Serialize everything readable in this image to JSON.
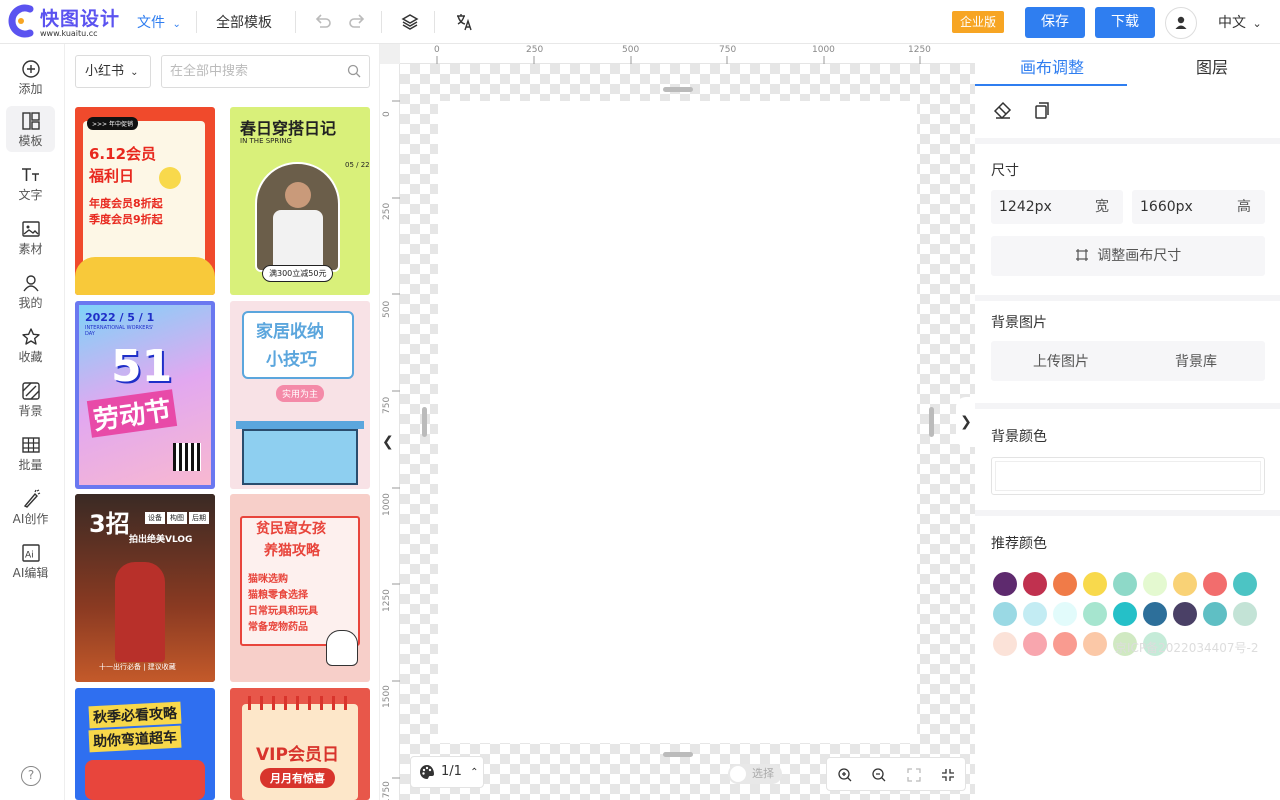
{
  "topbar": {
    "brand": "快图设计",
    "brand_url": "www.kuaitu.cc",
    "file_menu": "文件",
    "all_templates": "全部模板",
    "enterprise_badge": "企业版",
    "save_label": "保存",
    "download_label": "下载",
    "language": "中文"
  },
  "sidebar": {
    "items": [
      {
        "label": "添加",
        "icon": "plus-circle-icon"
      },
      {
        "label": "模板",
        "icon": "template-icon"
      },
      {
        "label": "文字",
        "icon": "text-icon"
      },
      {
        "label": "素材",
        "icon": "image-icon"
      },
      {
        "label": "我的",
        "icon": "user-icon"
      },
      {
        "label": "收藏",
        "icon": "star-icon"
      },
      {
        "label": "背景",
        "icon": "background-icon"
      },
      {
        "label": "批量",
        "icon": "grid-icon"
      },
      {
        "label": "AI创作",
        "icon": "ai-brush-icon"
      },
      {
        "label": "AI编辑",
        "icon": "ai-edit-icon"
      }
    ],
    "help": "?"
  },
  "templates": {
    "category": "小红书",
    "search_placeholder": "在全部中搜索",
    "cards": [
      {
        "title": "6.12会员福利日",
        "lines": [
          "年度会员8折起",
          "季度会员9折起"
        ],
        "tag": ">>> 年中促销",
        "bg": "#f04a2c",
        "inner": "#fdf7e6",
        "accent": "#e8281e"
      },
      {
        "title": "春日穿搭日记",
        "lines": [
          "IN THE SPRING",
          "满300立减50元"
        ],
        "date": "05 / 22",
        "bg": "#d9f07a",
        "inner": "#fbf9e8",
        "accent": "#222"
      },
      {
        "title": "51劳动节",
        "lines": [
          "2022 / 5 / 1",
          "INTERNATIONAL WORKERS' DAY"
        ],
        "big": "51",
        "sub": "劳动节",
        "bg": "#6a78f0",
        "inner": "#b8e0f8",
        "accent": "#1f2fc8"
      },
      {
        "title": "家居收纳小技巧",
        "lines": [
          "家居收纳",
          "小技巧"
        ],
        "tag": "实用为主",
        "bg": "#f8e2e6",
        "inner": "#fdf3f5",
        "accent": "#5ba6dd"
      },
      {
        "title": "3招拍出绝美VLOG",
        "lines": [
          "3招",
          "拍出绝美VLOG"
        ],
        "tags": [
          "设备",
          "构图",
          "后期"
        ],
        "footer": "十一出行必备 | 建议收藏",
        "bg": "#5a2a1c",
        "inner": "#7a3a22",
        "accent": "#fff"
      },
      {
        "title": "贫民窟女孩养猫攻略",
        "lines": [
          "贫民窟女孩",
          "养猫攻略"
        ],
        "list": [
          "猫咪选购",
          "猫粮零食选择",
          "日常玩具和玩具",
          "常备宠物药品"
        ],
        "bg": "#f7cfc9",
        "inner": "#fdf0ee",
        "accent": "#e8453c"
      },
      {
        "title": "秋季必看攻略 助你弯道超车",
        "lines": [
          "秋季必看攻略",
          "助你弯道超车"
        ],
        "bg": "#2f6ff0",
        "inner": "#f8d84a",
        "accent": "#222"
      },
      {
        "title": "VIP会员日",
        "lines": [
          "VIP会员日",
          "月月有惊喜"
        ],
        "bg": "#e8574a",
        "inner": "#fde7c9",
        "accent": "#d8342c"
      }
    ]
  },
  "canvas": {
    "ruler_top": [
      "0",
      "250",
      "500",
      "750",
      "1000",
      "1250"
    ],
    "ruler_left": [
      "0",
      "250",
      "500",
      "750",
      "1000",
      "1250",
      "1500",
      "1750"
    ],
    "page_indicator": "1/1",
    "select_toggle": "选择"
  },
  "right_panel": {
    "tab_canvas": "画布调整",
    "tab_layers": "图层",
    "size_label": "尺寸",
    "width_value": "1242px",
    "width_unit": "宽",
    "height_value": "1660px",
    "height_unit": "高",
    "resize_button": "调整画布尺寸",
    "bg_image_label": "背景图片",
    "upload_image": "上传图片",
    "bg_library": "背景库",
    "bg_color_label": "背景颜色",
    "bg_color_value": "#ffffff",
    "recommend_label": "推荐颜色",
    "swatches": [
      "#5e2a6e",
      "#c0314f",
      "#f07b48",
      "#f8d94c",
      "#8ed9c8",
      "#e4f9d0",
      "#f9d276",
      "#f26d6d",
      "#4cc4c4",
      "#9ad9e4",
      "#c3ecf3",
      "#e2fbfb",
      "#a6e5cf",
      "#25c0c8",
      "#2d6f9a",
      "#4a4066",
      "#5fbfc4",
      "#c3e3d6",
      "#fbe2d8",
      "#f8a6ae",
      "#f99b90",
      "#fbc8a7",
      "#d0e9c2",
      "#c5ebd8"
    ],
    "icp": "京ICP备2022034407号-2"
  }
}
